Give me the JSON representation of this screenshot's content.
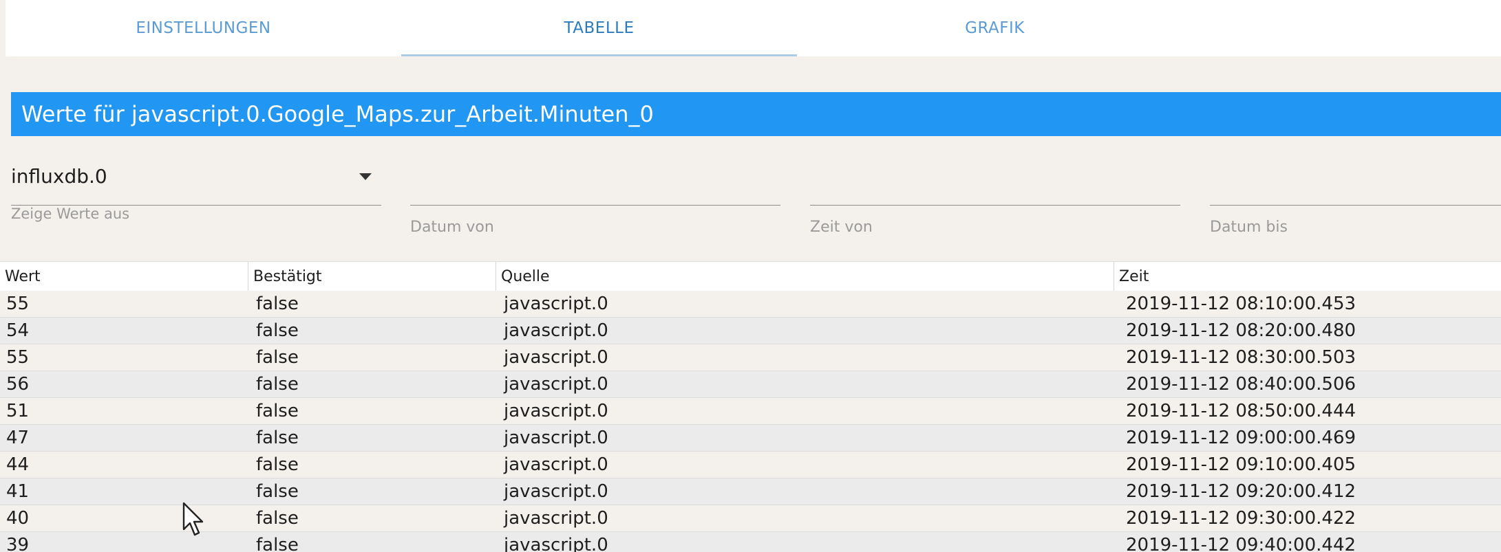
{
  "tabs": [
    "EINSTELLUNGEN",
    "TABELLE",
    "GRAFIK"
  ],
  "title": "Werte für javascript.0.Google_Maps.zur_Arbeit.Minuten_0",
  "instance": {
    "value": "influxdb.0",
    "helper": "Zeige Werte aus"
  },
  "filters": {
    "date_from": "Datum von",
    "time_from": "Zeit von",
    "date_to": "Datum bis"
  },
  "table": {
    "columns": [
      "Wert",
      "Bestätigt",
      "Quelle",
      "Zeit"
    ],
    "rows": [
      [
        "55",
        "false",
        "javascript.0",
        "2019-11-12 08:10:00.453"
      ],
      [
        "54",
        "false",
        "javascript.0",
        "2019-11-12 08:20:00.480"
      ],
      [
        "55",
        "false",
        "javascript.0",
        "2019-11-12 08:30:00.503"
      ],
      [
        "56",
        "false",
        "javascript.0",
        "2019-11-12 08:40:00.506"
      ],
      [
        "51",
        "false",
        "javascript.0",
        "2019-11-12 08:50:00.444"
      ],
      [
        "47",
        "false",
        "javascript.0",
        "2019-11-12 09:00:00.469"
      ],
      [
        "44",
        "false",
        "javascript.0",
        "2019-11-12 09:10:00.405"
      ],
      [
        "41",
        "false",
        "javascript.0",
        "2019-11-12 09:20:00.412"
      ],
      [
        "40",
        "false",
        "javascript.0",
        "2019-11-12 09:30:00.422"
      ],
      [
        "39",
        "false",
        "javascript.0",
        "2019-11-12 09:40:00.442"
      ]
    ]
  },
  "icons": {
    "select_arrow": "caret-down-icon",
    "cursor": "mouse-pointer-icon"
  },
  "colors": {
    "accent": "#2196f3",
    "tab_text": "#5b9bd5",
    "tab_active_text": "#2b7bc0"
  }
}
